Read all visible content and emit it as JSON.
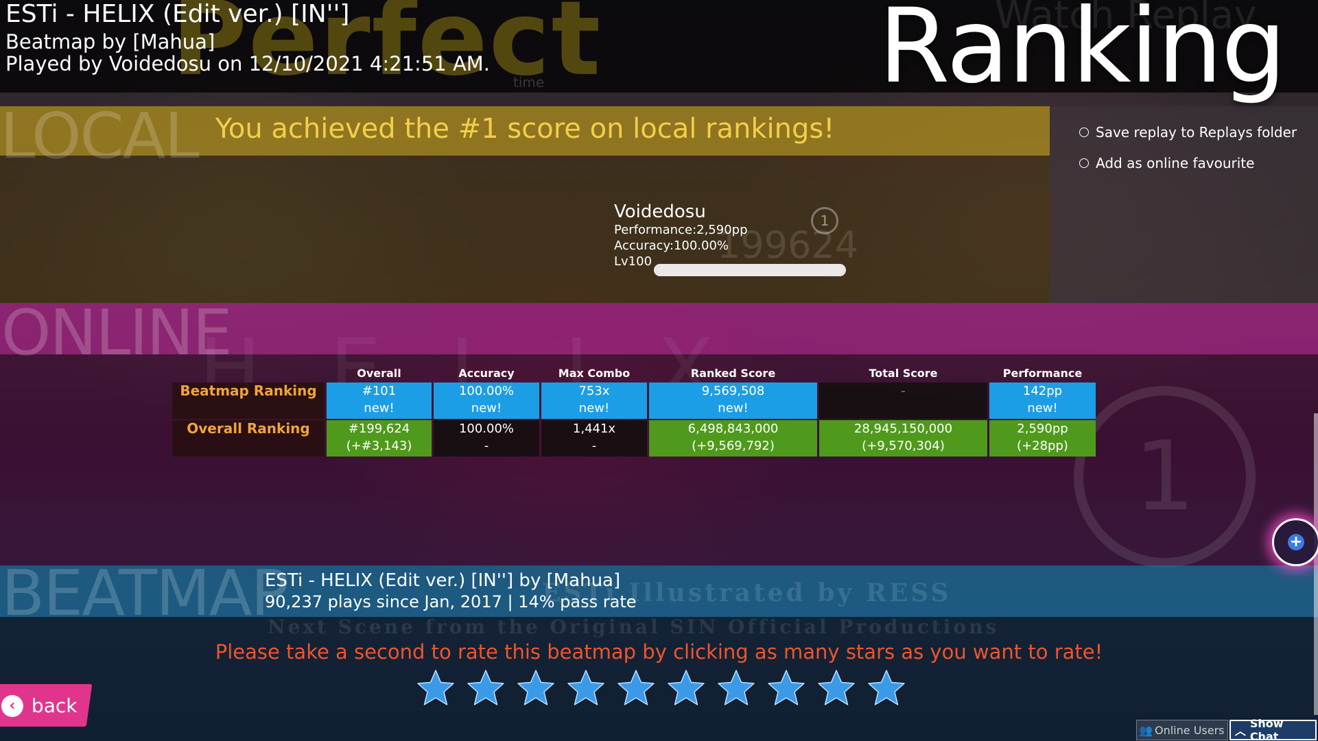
{
  "header": {
    "song_title": "ESTi - HELIX (Edit ver.) [IN'']",
    "beatmap_by": "Beatmap by [Mahua]",
    "played_by": "Played by Voidedosu on 12/10/2021 4:21:51 AM.",
    "ranking_title": "Ranking",
    "grade_ghost": "Perfect",
    "watch_replay_ghost": "Watch Replay",
    "time_ghost": "time"
  },
  "local": {
    "section_label": "LOCAL",
    "message": "You achieved the #1 score on local rankings!",
    "player": {
      "name": "Voidedosu",
      "performance": "Performance:2,590pp",
      "accuracy": "Accuracy:100.00%",
      "level": "Lv100",
      "level_progress": 1.0,
      "rank_badge": "1",
      "rank_ghost": "199624"
    }
  },
  "options": {
    "save_replay": "Save replay to Replays folder",
    "add_favourite": "Add as online favourite"
  },
  "online": {
    "section_label": "ONLINE",
    "helix_ghost": "HELIX",
    "big_rank": "1",
    "columns": [
      "Overall",
      "Accuracy",
      "Max Combo",
      "Ranked Score",
      "Total Score",
      "Performance"
    ],
    "beatmap_ranking": {
      "label": "Beatmap Ranking",
      "overall": [
        "#101",
        "new!"
      ],
      "accuracy": [
        "100.00%",
        "new!"
      ],
      "max_combo": [
        "753x",
        "new!"
      ],
      "ranked_score": [
        "9,569,508",
        "new!"
      ],
      "total_score": [
        "-",
        ""
      ],
      "performance": [
        "142pp",
        "new!"
      ]
    },
    "overall_ranking": {
      "label": "Overall Ranking",
      "overall": [
        "#199,624",
        "(+#3,143)"
      ],
      "accuracy": [
        "100.00%",
        "-"
      ],
      "max_combo": [
        "1,441x",
        "-"
      ],
      "ranked_score": [
        "6,498,843,000",
        "(+9,569,792)"
      ],
      "total_score": [
        "28,945,150,000",
        "(+9,570,304)"
      ],
      "performance": [
        "2,590pp",
        "(+28pp)"
      ]
    }
  },
  "beatmap": {
    "section_label": "BEATMAP",
    "name": "ESTi - HELIX (Edit ver.) [IN''] by [Mahua]",
    "stats": "90,237 plays since Jan, 2017 | 14% pass rate",
    "bg_illustrated": "ESTi  Illustrated by RESS",
    "bg_next_scene": "Next Scene from the Original SIN Official Productions",
    "rate_message": "Please take a second to rate this beatmap by clicking as many stars as you want to rate!",
    "star_count": 10
  },
  "controls": {
    "back_label": "back",
    "online_users_label": "Online Users",
    "show_chat_label": "Show Chat"
  },
  "colors": {
    "local_banner": "#aa8c1e",
    "local_text": "#f3cf4a",
    "online_banner": "#aa238c",
    "beatmap_banner": "#1e78aa",
    "cell_blue": "#1c9ee6",
    "cell_green": "#4f9a1c",
    "rate_text": "#f0552b",
    "back_button": "#e1358d",
    "star": "#3a9ae8"
  }
}
